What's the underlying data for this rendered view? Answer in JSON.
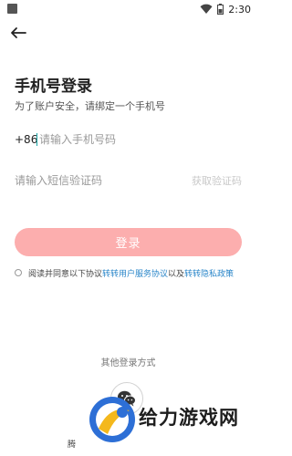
{
  "status_bar": {
    "time": "2:30",
    "icons": [
      "notification-square-icon",
      "wifi-icon",
      "battery-icon"
    ]
  },
  "header": {
    "back_icon": "back-arrow-icon"
  },
  "title": "手机号登录",
  "subtitle": "为了账户安全，请绑定一个手机号",
  "phone": {
    "prefix": "+86",
    "placeholder": "请输入手机号码",
    "value": ""
  },
  "code": {
    "placeholder": "请输入短信验证码",
    "value": "",
    "get_code_label": "获取验证码"
  },
  "login_button": "登录",
  "agreement": {
    "text_before": "阅读并同意以下协议",
    "link1": "转转用户服务协议",
    "separator": "以及",
    "link2": "转转隐私政策",
    "checked": false
  },
  "other_login": {
    "label": "其他登录方式",
    "methods": [
      "wechat-icon"
    ]
  },
  "partial_text": "腾",
  "watermark": {
    "text": "给力游戏网"
  },
  "colors": {
    "accent_teal": "#19a6a6",
    "login_button_bg": "#fcaeae",
    "link": "#2a86c9",
    "disabled_text": "#c8c8c8",
    "watermark_blue": "#2d6fd6",
    "watermark_yellow": "#f4b81c"
  }
}
